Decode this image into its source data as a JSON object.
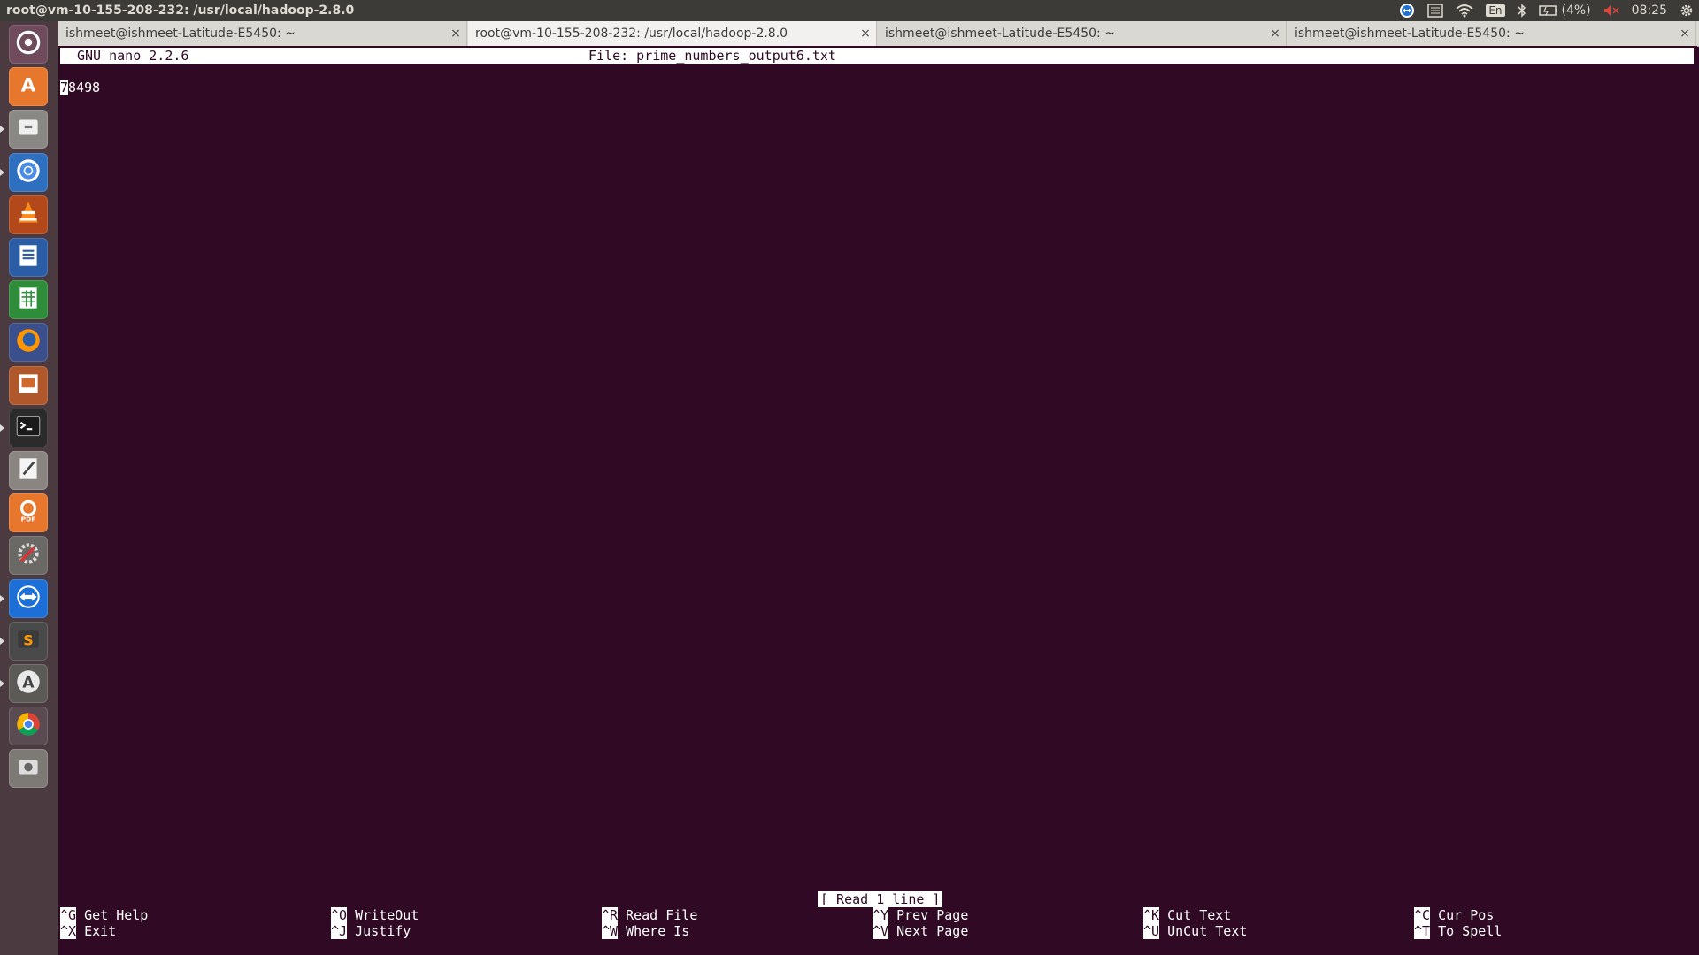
{
  "panel": {
    "window_title": "root@vm-10-155-208-232: /usr/local/hadoop-2.8.0",
    "keyboard_layout": "En",
    "battery": "(4%)",
    "clock": "08:25"
  },
  "launcher": {
    "icons": [
      "dash-home-icon",
      "software-center-icon",
      "files-icon",
      "chromium-icon",
      "vlc-icon",
      "writer-icon",
      "calc-icon",
      "firefox-icon",
      "impress-icon",
      "terminal-icon",
      "text-editor-icon",
      "pdf-editor-icon",
      "system-settings-icon",
      "teamviewer-icon",
      "sublime-text-icon",
      "software-updater-icon",
      "chrome-icon",
      "screenshot-icon"
    ]
  },
  "tabs": [
    {
      "label": "ishmeet@ishmeet-Latitude-E5450: ~",
      "active": false
    },
    {
      "label": "root@vm-10-155-208-232: /usr/local/hadoop-2.8.0",
      "active": true
    },
    {
      "label": "ishmeet@ishmeet-Latitude-E5450: ~",
      "active": false
    },
    {
      "label": "ishmeet@ishmeet-Latitude-E5450: ~",
      "active": false
    }
  ],
  "tab_close_glyph": "×",
  "nano": {
    "version": "GNU nano 2.2.6",
    "file_label": "File: prime_numbers_output6.txt",
    "content_cursor_char": "7",
    "content_rest": "8498",
    "status": "[ Read 1 line ]",
    "shortcuts": [
      {
        "key": "^G",
        "label": "Get Help"
      },
      {
        "key": "^O",
        "label": "WriteOut"
      },
      {
        "key": "^R",
        "label": "Read File"
      },
      {
        "key": "^Y",
        "label": "Prev Page"
      },
      {
        "key": "^K",
        "label": "Cut Text"
      },
      {
        "key": "^C",
        "label": "Cur Pos"
      },
      {
        "key": "^X",
        "label": "Exit"
      },
      {
        "key": "^J",
        "label": "Justify"
      },
      {
        "key": "^W",
        "label": "Where Is"
      },
      {
        "key": "^V",
        "label": "Next Page"
      },
      {
        "key": "^U",
        "label": "UnCut Text"
      },
      {
        "key": "^T",
        "label": "To Spell"
      }
    ]
  },
  "colors": {
    "terminal_bg": "#300a24",
    "panel_bg": "#3c3b37",
    "muted_volume": "#e0443a"
  }
}
